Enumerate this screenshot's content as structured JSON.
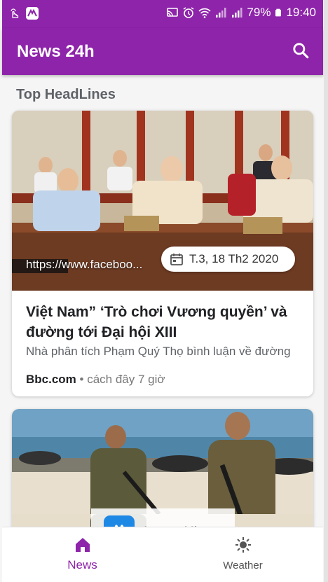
{
  "status_bar": {
    "battery": "79%",
    "time": "19:40",
    "icons": [
      "hand-touch-icon",
      "apowermirror-icon",
      "cast-icon",
      "alarm-icon",
      "wifi-icon",
      "signal-icon",
      "signal-icon",
      "battery-icon"
    ]
  },
  "app_bar": {
    "title": "News 24h",
    "search_icon": "search-icon"
  },
  "section": {
    "title": "Top HeadLines"
  },
  "articles": [
    {
      "url_overlay": "https://www.faceboo...",
      "date": "T.3, 18 Th2 2020",
      "title": "Việt Nam” ‘Trò chơi Vương quyền’ và đường tới Đại hội XIII",
      "description": "Nhà phân tích Phạm Quý Thọ bình luận về đường",
      "source": "Bbc.com",
      "time_ago": "cách đây 7 giờ"
    }
  ],
  "watermark": {
    "text": "ApowerMirror"
  },
  "bottom_nav": {
    "items": [
      {
        "label": "News",
        "icon": "home-icon",
        "active": true
      },
      {
        "label": "Weather",
        "icon": "sun-icon",
        "active": false
      }
    ]
  },
  "colors": {
    "primary": "#8e24aa",
    "background": "#f5f5f5",
    "card": "#ffffff"
  }
}
